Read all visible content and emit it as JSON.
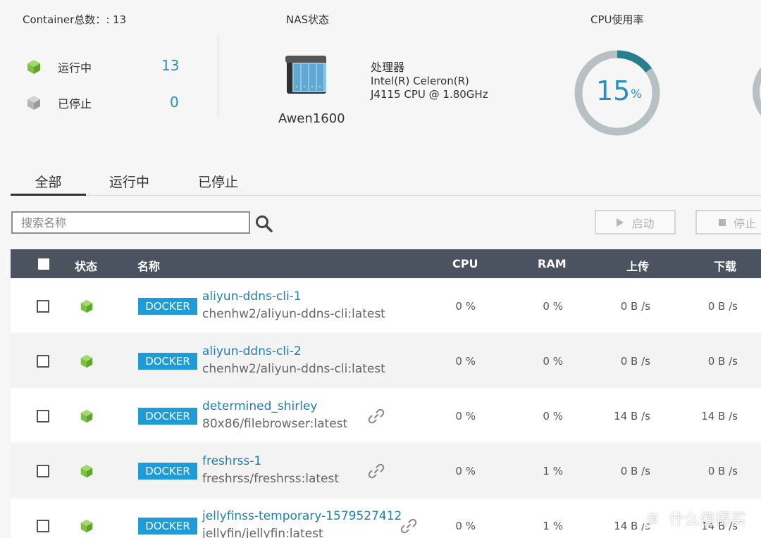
{
  "summary": {
    "container_total_label": "Container总数：",
    "container_total_value": ": 13",
    "running_label": "运行中",
    "running_count": "13",
    "stopped_label": "已停止",
    "stopped_count": "0"
  },
  "nas": {
    "title": "NAS状态",
    "device_name": "Awen1600",
    "processor_label": "处理器",
    "processor_line1": "Intel(R) Celeron(R)",
    "processor_line2": "J4115 CPU @ 1.80GHz"
  },
  "cpu": {
    "title": "CPU使用率",
    "usage_value": "15",
    "usage_unit": "%",
    "usage_fraction": 0.15
  },
  "tabs": [
    {
      "label": "全部",
      "active": true
    },
    {
      "label": "运行中",
      "active": false
    },
    {
      "label": "已停止",
      "active": false
    }
  ],
  "toolbar": {
    "search_placeholder": "搜索名称",
    "start_label": "启动",
    "stop_label": "停止"
  },
  "table": {
    "headers": {
      "status": "状态",
      "name": "名称",
      "cpu": "CPU",
      "ram": "RAM",
      "upload": "上传",
      "download": "下载"
    },
    "rows": [
      {
        "type": "DOCKER",
        "name": "aliyun-ddns-cli-1",
        "image": "chenhw2/aliyun-ddns-cli:latest",
        "has_link": false,
        "cpu": "0 %",
        "ram": "0 %",
        "upload": "0 B /s",
        "download": "0 B /s"
      },
      {
        "type": "DOCKER",
        "name": "aliyun-ddns-cli-2",
        "image": "chenhw2/aliyun-ddns-cli:latest",
        "has_link": false,
        "cpu": "0 %",
        "ram": "0 %",
        "upload": "0 B /s",
        "download": "0 B /s"
      },
      {
        "type": "DOCKER",
        "name": "determined_shirley",
        "image": "80x86/filebrowser:latest",
        "has_link": true,
        "cpu": "0 %",
        "ram": "0 %",
        "upload": "14 B /s",
        "download": "14 B /s"
      },
      {
        "type": "DOCKER",
        "name": "freshrss-1",
        "image": "freshrss/freshrss:latest",
        "has_link": true,
        "cpu": "0 %",
        "ram": "1 %",
        "upload": "0 B /s",
        "download": "0 B /s"
      },
      {
        "type": "DOCKER",
        "name": "jellyfinss-temporary-1579527412",
        "image": "jellyfin/jellyfin:latest",
        "has_link": true,
        "cpu": "0 %",
        "ram": "1 %",
        "upload": "14 B /s",
        "download": "14 B /s"
      }
    ]
  },
  "watermark": {
    "text": "什么值得买"
  },
  "colors": {
    "accent": "#2a8fc0",
    "docker_badge": "#1f9bd7",
    "running_green": "#7cc242",
    "header_bg": "#4c5360",
    "gauge_track": "#b7c0c3",
    "gauge_fill": "#2a7f8f"
  }
}
